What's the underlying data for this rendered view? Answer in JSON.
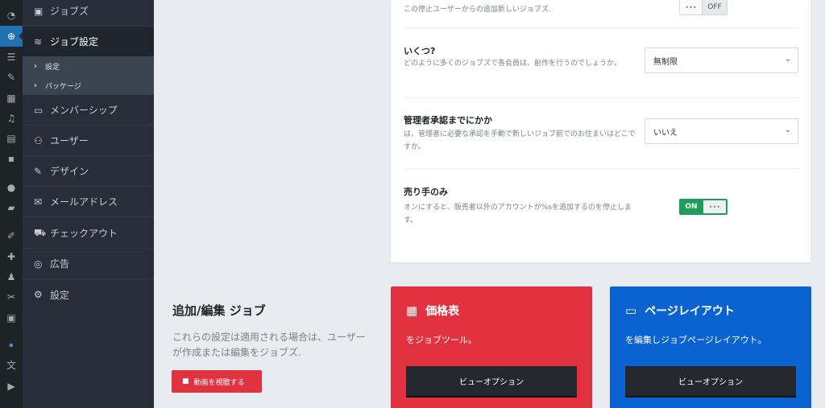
{
  "rail": {
    "icons": [
      "dashboard-icon",
      "jobs-plugin-icon",
      "list-icon",
      "pin-icon",
      "grid-icon",
      "media-icon",
      "pages-icon",
      "comments-icon",
      "elementor-icon",
      "folder-icon",
      "brush-icon",
      "plugins-icon",
      "users-icon",
      "tools-icon",
      "settings-icon",
      "translate-icon",
      "play-icon"
    ]
  },
  "sidebar": {
    "items": [
      {
        "label": "ジョブズ",
        "icon": "briefcase-icon"
      },
      {
        "label": "ジョブ設定",
        "icon": "layers-icon"
      },
      {
        "label": "メンバーシップ",
        "icon": "id-card-icon"
      },
      {
        "label": "ユーザー",
        "icon": "users-icon"
      },
      {
        "label": "デザイン",
        "icon": "brush-icon"
      },
      {
        "label": "メールアドレス",
        "icon": "envelope-icon"
      },
      {
        "label": "チェックアウト",
        "icon": "cart-icon"
      },
      {
        "label": "広告",
        "icon": "target-icon"
      },
      {
        "label": "設定",
        "icon": "gear-icon"
      }
    ],
    "sub_items": [
      {
        "label": "設定"
      },
      {
        "label": "パッケージ"
      }
    ]
  },
  "card": {
    "row0_desc": "この停止ユーザーからの追加新しいジョブズ.",
    "row0_toggle": {
      "state": "OFF",
      "knob": "•••"
    },
    "row1_title": "いくつ?",
    "row1_desc": "どのように多くのジョブズで各会員は、創作を行うのでしょうか。",
    "row1_select": "無制限",
    "row2_title": "管理者承認までにかか",
    "row2_desc": "は、管理者に必要な承認を手動で新しいジョブ前でのお住まいはどこですか。",
    "row2_select": "いいえ",
    "row3_title": "売り手のみ",
    "row3_desc": "オンにすると、販売者以外のアカウントが%sを追加するのを停止します。",
    "row3_toggle": {
      "state": "ON",
      "knob": "•••"
    },
    "caret": "⌄"
  },
  "bottom": {
    "title": "追加/編集 ジョブ",
    "desc": "これらの設定は適用される場合は、ユーザーが作成または編集をジョブズ.",
    "video_button": "動画を視聴する"
  },
  "tiles": {
    "pricing": {
      "title": "価格表",
      "desc": "をジョブツール。",
      "button": "ビューオプション",
      "color": "#e23240",
      "icon": "table-icon"
    },
    "layout": {
      "title": "ページレイアウト",
      "desc": "を編集しジョブページレイアウト。",
      "button": "ビューオプション",
      "color": "#0a63d1",
      "icon": "monitor-icon"
    }
  }
}
